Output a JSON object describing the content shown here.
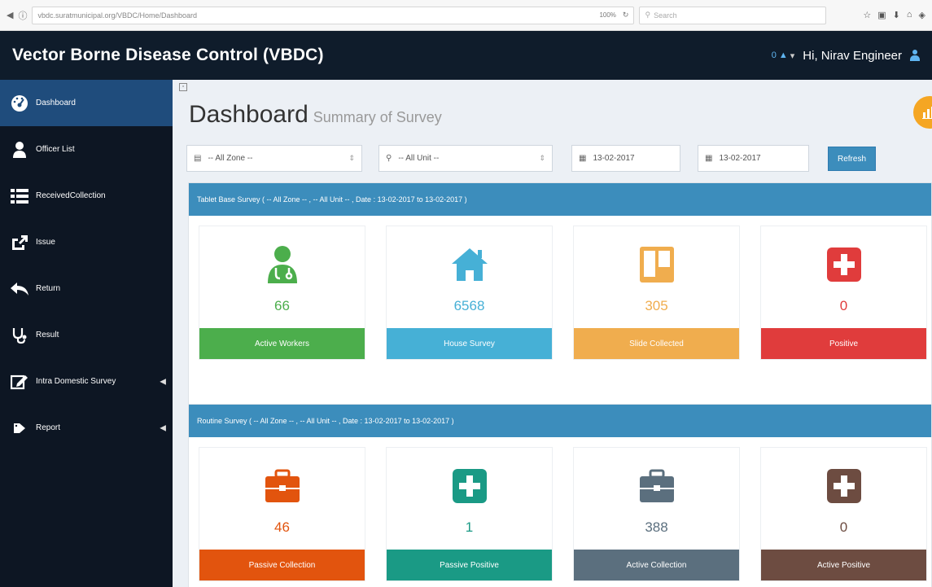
{
  "browser": {
    "url": "vbdc.suratmunicipal.org/VBDC/Home/Dashboard",
    "zoom": "100%",
    "search_placeholder": "Search"
  },
  "header": {
    "title": "Vector Borne Disease Control (VBDC)",
    "notif_count": "0",
    "greeting": "Hi, Nirav Engineer"
  },
  "sidebar": {
    "items": [
      {
        "label": "Dashboard",
        "icon": "tachometer-icon",
        "active": true
      },
      {
        "label": "Officer List",
        "icon": "user-icon"
      },
      {
        "label": "ReceivedCollection",
        "icon": "list-icon"
      },
      {
        "label": "Issue",
        "icon": "share-icon"
      },
      {
        "label": "Return",
        "icon": "reply-icon"
      },
      {
        "label": "Result",
        "icon": "stethoscope-icon"
      },
      {
        "label": "Intra Domestic Survey",
        "icon": "edit-icon",
        "submenu": true
      },
      {
        "label": "Report",
        "icon": "tag-icon",
        "submenu": true
      }
    ]
  },
  "main": {
    "title": "Dashboard",
    "subtitle": "Summary of Survey"
  },
  "filters": {
    "zone": "-- All Zone --",
    "unit": "-- All Unit --",
    "from_date": "13-02-2017",
    "to_date": "13-02-2017",
    "refresh_label": "Refresh"
  },
  "tablet_survey": {
    "heading": "Tablet Base Survey ( -- All Zone -- , -- All Unit -- , Date : 13-02-2017 to 13-02-2017 )",
    "cards": [
      {
        "value": "66",
        "label": "Active Workers",
        "color": "#4cae4c",
        "icon": "user-md-icon"
      },
      {
        "value": "6568",
        "label": "House Survey",
        "color": "#46b0d6",
        "icon": "home-icon"
      },
      {
        "value": "305",
        "label": "Slide Collected",
        "color": "#f0ad4e",
        "icon": "trello-icon"
      },
      {
        "value": "0",
        "label": "Positive",
        "color": "#e03c3c",
        "icon": "plus-square-icon"
      }
    ]
  },
  "routine_survey": {
    "heading": "Routine Survey ( -- All Zone -- , -- All Unit -- , Date : 13-02-2017 to 13-02-2017 )",
    "cards": [
      {
        "value": "46",
        "label": "Passive Collection",
        "color": "#e2540e",
        "icon": "briefcase-icon"
      },
      {
        "value": "1",
        "label": "Passive Positive",
        "color": "#1a9a85",
        "icon": "plus-square-icon"
      },
      {
        "value": "388",
        "label": "Active Collection",
        "color": "#5b6f7e",
        "icon": "briefcase-icon"
      },
      {
        "value": "0",
        "label": "Active Positive",
        "color": "#6d4c41",
        "icon": "plus-square-icon"
      }
    ]
  }
}
